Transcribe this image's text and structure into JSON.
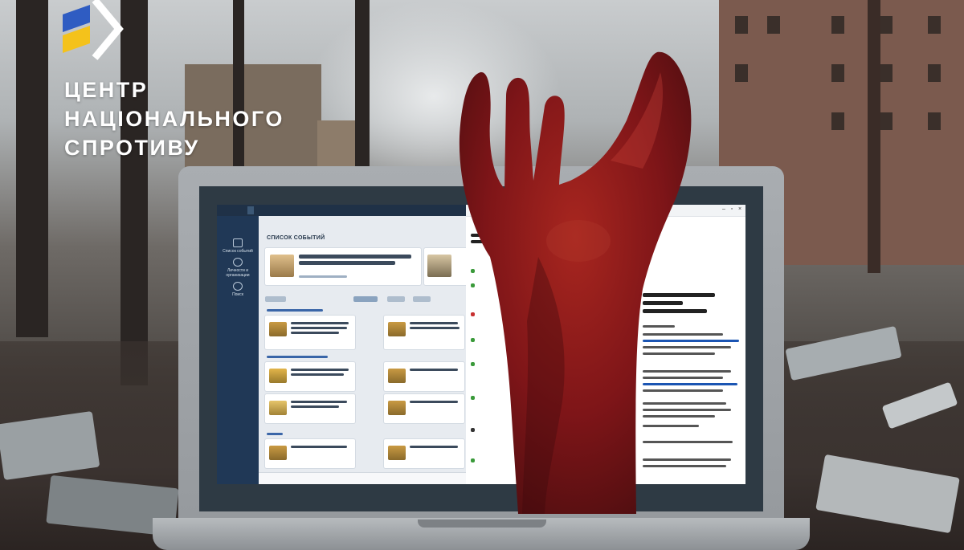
{
  "branding": {
    "title_lines": [
      "ЦЕНТР",
      "НАЦІОНАЛЬНОГО",
      "СПРОТИВУ"
    ],
    "logo": {
      "icon": "ukraine-flag-chevron-logo",
      "colors": {
        "blue": "#2f5cc2",
        "yellow": "#f4c21b",
        "chevron": "#ffffff"
      }
    }
  },
  "laptop_screen": {
    "main_heading": "СПИСОК СОБЫТИЙ",
    "sidebar_items": [
      "Список событий",
      "Личности и организации",
      "Поиск"
    ]
  },
  "colors": {
    "blood": "#8a1418",
    "screen_sidebar": "#203856"
  }
}
